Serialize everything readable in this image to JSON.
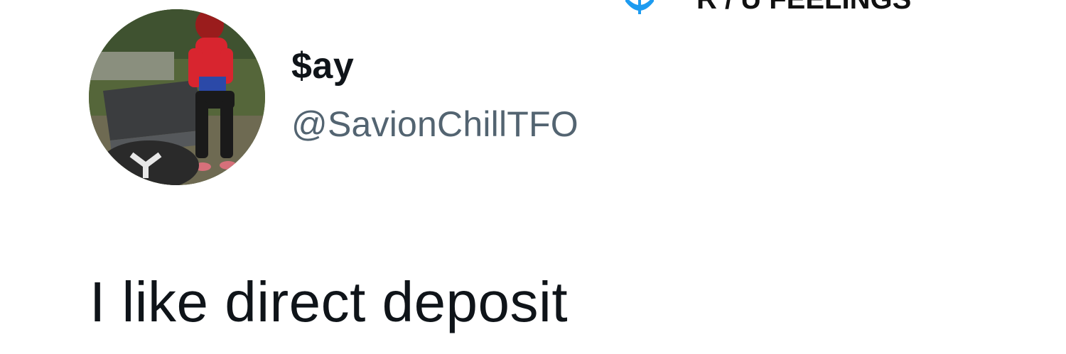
{
  "tweet": {
    "author": {
      "display_name": "$ay",
      "handle": "@SavionChillTFO",
      "avatar": "profile-photo"
    },
    "text": "I like direct deposit"
  },
  "watermark": {
    "icon": "blue-logo-icon",
    "text": "R / U FEELINGS",
    "color": "#1d9bf0"
  },
  "colors": {
    "name": "#0f1419",
    "handle": "#536471",
    "background": "#ffffff"
  }
}
